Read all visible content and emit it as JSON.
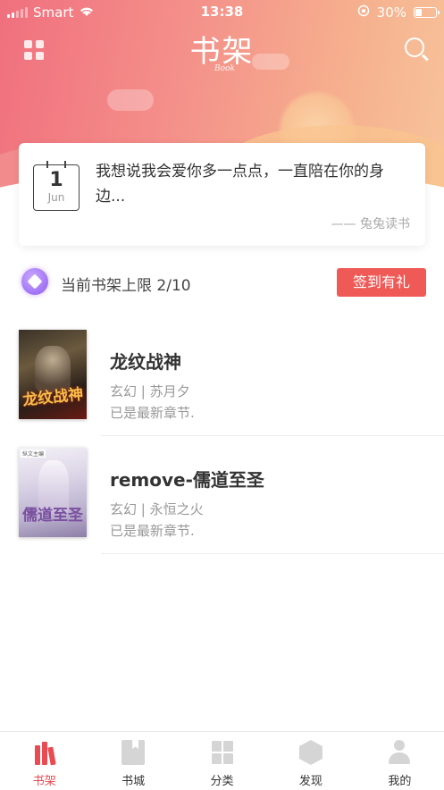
{
  "status_bar": {
    "carrier": "Smart",
    "time": "13:38",
    "battery": "30%",
    "battery_level": 0.3
  },
  "header": {
    "title": "书架",
    "subtitle": "Book"
  },
  "quote": {
    "day": "1",
    "month": "Jun",
    "text": "我想说我会爱你多一点点，一直陪在你的身边...",
    "source": "—— 兔兔读书"
  },
  "shelf": {
    "limit_text": "当前书架上限 2/10",
    "signin_label": "签到有礼"
  },
  "books": [
    {
      "title": "龙纹战神",
      "meta": "玄幻 | 苏月夕",
      "update": "已是最新章节.",
      "cover_text": "龙纹战神"
    },
    {
      "title": "remove-儒道至圣",
      "meta": "玄幻 | 永恒之火",
      "update": "已是最新章节.",
      "cover_text": "儒道至圣",
      "cover_tag": "纵文主编"
    }
  ],
  "tabs": [
    {
      "label": "书架",
      "icon": "bookshelf-icon",
      "active": true
    },
    {
      "label": "书城",
      "icon": "bookstore-icon",
      "active": false
    },
    {
      "label": "分类",
      "icon": "category-icon",
      "active": false
    },
    {
      "label": "发现",
      "icon": "discover-icon",
      "active": false
    },
    {
      "label": "我的",
      "icon": "profile-icon",
      "active": false
    }
  ],
  "colors": {
    "accent": "#e94b52",
    "button": "#ef5a57",
    "gradient_start": "#f0707e",
    "gradient_end": "#f7c49a"
  }
}
